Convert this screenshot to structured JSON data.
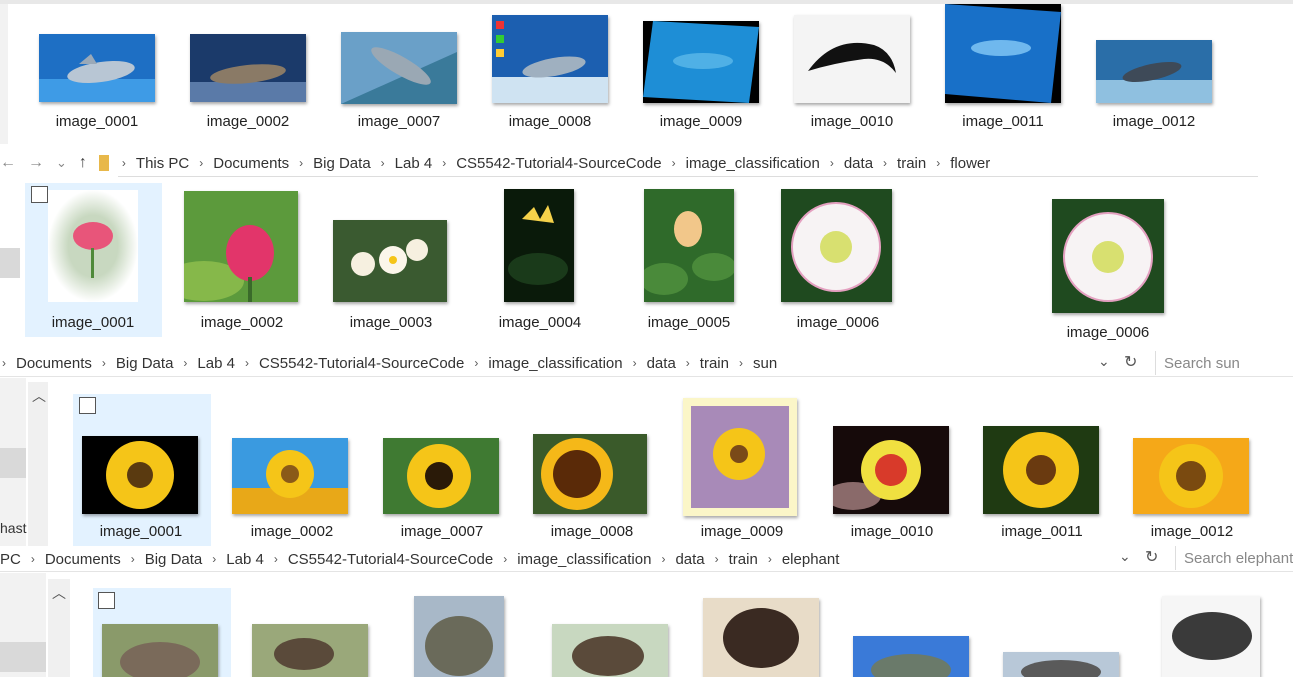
{
  "dolphin": {
    "captions": [
      "image_0001",
      "image_0002",
      "image_0007",
      "image_0008",
      "image_0009",
      "image_0010",
      "image_0011",
      "image_0012"
    ]
  },
  "flower": {
    "address": {
      "back_icon": "←",
      "forward_icon": "→",
      "recent_icon": "⌄",
      "up_icon": "↑",
      "segments": [
        "This PC",
        "Documents",
        "Big Data",
        "Lab 4",
        "CS5542-Tutorial4-SourceCode",
        "image_classification",
        "data",
        "train",
        "flower"
      ]
    },
    "captions": [
      "image_0001",
      "image_0002",
      "image_0003",
      "image_0004",
      "image_0005",
      "image_0006",
      "image_0006"
    ]
  },
  "sun": {
    "address": {
      "segments": [
        "Documents",
        "Big Data",
        "Lab 4",
        "CS5542-Tutorial4-SourceCode",
        "image_classification",
        "data",
        "train",
        "sun"
      ]
    },
    "search_placeholder": "Search sun",
    "sidebar_fragment": "hast",
    "captions": [
      "image_0001",
      "image_0002",
      "image_0007",
      "image_0008",
      "image_0009",
      "image_0010",
      "image_0011",
      "image_0012"
    ]
  },
  "elephant": {
    "address": {
      "lead": "PC",
      "segments": [
        "Documents",
        "Big Data",
        "Lab 4",
        "CS5542-Tutorial4-SourceCode",
        "image_classification",
        "data",
        "train",
        "elephant"
      ]
    },
    "search_placeholder": "Search elephant"
  },
  "colors": {
    "selection": "#cce8ff",
    "sky_blue": "#2a7fd4",
    "lotus_pink": "#e8557a",
    "sunflower_yellow": "#f5c518",
    "leaf_green": "#4f8a3a"
  }
}
